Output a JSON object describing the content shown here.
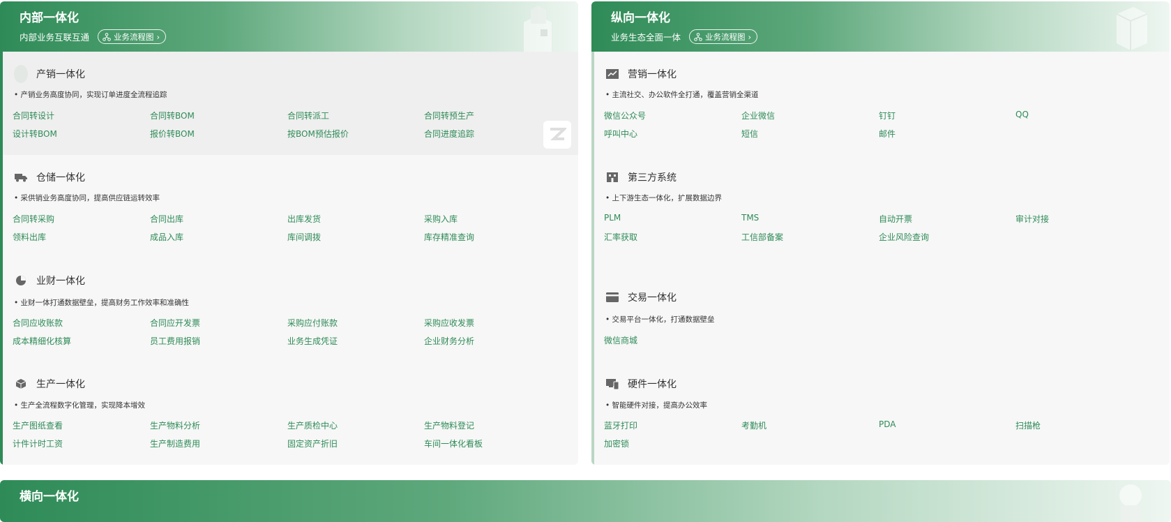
{
  "left": {
    "title": "内部一体化",
    "subtitle": "内部业务互联互通",
    "flow_label": "业务流程图",
    "sections": [
      {
        "title": "产销一体化",
        "desc": "• 产销业务高度协同，实现订单进度全流程追踪",
        "icon": "circle-placeholder-icon",
        "links": [
          "合同转设计",
          "合同转BOM",
          "合同转派工",
          "合同转预生产",
          "设计转BOM",
          "报价转BOM",
          "按BOM预估报价",
          "合同进度追踪"
        ]
      },
      {
        "title": "仓储一体化",
        "desc": "• 采供销业务高度协同，提高供应链运转效率",
        "icon": "truck-icon",
        "links": [
          "合同转采购",
          "合同出库",
          "出库发货",
          "采购入库",
          "领料出库",
          "成品入库",
          "库间调拨",
          "库存精准查询"
        ]
      },
      {
        "title": "业财一体化",
        "desc": "• 业财一体打通数据壁垒，提高财务工作效率和准确性",
        "icon": "pie-chart-icon",
        "links": [
          "合同应收账款",
          "合同应开发票",
          "采购应付账款",
          "采购应收发票",
          "成本精细化核算",
          "员工费用报销",
          "业务生成凭证",
          "企业财务分析"
        ]
      },
      {
        "title": "生产一体化",
        "desc": "• 生产全流程数字化管理，实现降本增效",
        "icon": "box-icon",
        "links": [
          "生产图纸查看",
          "生产物料分析",
          "生产质检中心",
          "生产物料登记",
          "计件计时工资",
          "生产制造费用",
          "固定资产折旧",
          "车间一体化看板"
        ]
      }
    ]
  },
  "right": {
    "title": "纵向一体化",
    "subtitle": "业务生态全面一体",
    "flow_label": "业务流程图",
    "sections": [
      {
        "title": "营销一体化",
        "desc": "• 主流社交、办公软件全打通，覆盖营销全渠道",
        "icon": "line-chart-icon",
        "links": [
          "微信公众号",
          "企业微信",
          "钉钉",
          "QQ",
          "呼叫中心",
          "短信",
          "邮件"
        ]
      },
      {
        "title": "第三方系统",
        "desc": "• 上下游生态一体化，扩展数据边界",
        "icon": "building-icon",
        "links": [
          "PLM",
          "TMS",
          "自动开票",
          "审计对接",
          "汇率获取",
          "工信部备案",
          "企业风险查询"
        ]
      },
      {
        "title": "交易一体化",
        "desc": "• 交易平台一体化，打通数据壁垒",
        "icon": "card-icon",
        "links": [
          "微信商城"
        ]
      },
      {
        "title": "硬件一体化",
        "desc": "• 智能硬件对接，提高办公效率",
        "icon": "devices-icon",
        "links": [
          "蓝牙打印",
          "考勤机",
          "PDA",
          "扫描枪",
          "加密锁"
        ]
      }
    ]
  },
  "bottom": {
    "title": "横向一体化"
  },
  "colors": {
    "accent": "#2e8b57",
    "link": "#2e8b57",
    "header_gradient_start": "#2e8b57"
  }
}
